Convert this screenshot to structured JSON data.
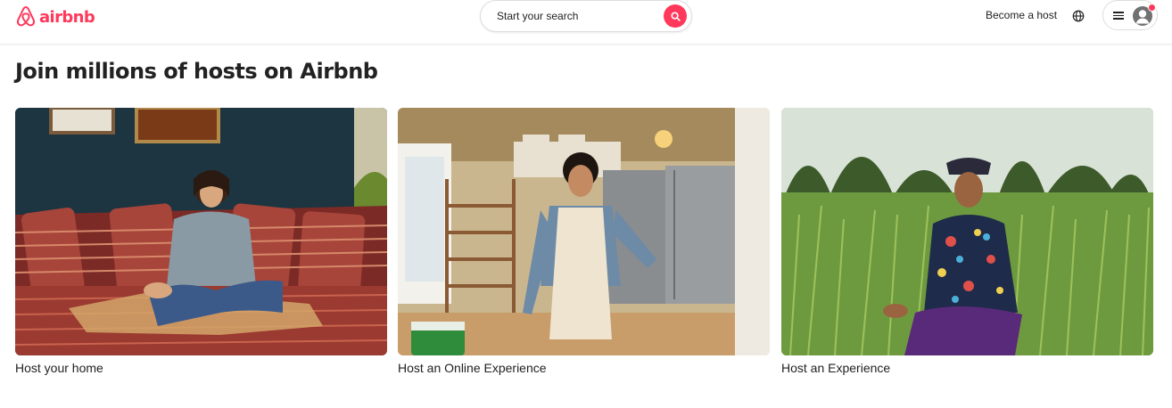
{
  "header": {
    "logo_text": "airbnb",
    "search_placeholder": "Start your search",
    "become_host": "Become a host",
    "icons": {
      "search": "search-icon",
      "globe": "globe-icon",
      "menu": "hamburger-menu-icon",
      "avatar": "user-avatar-icon"
    }
  },
  "main": {
    "title": "Join millions of hosts on Airbnb",
    "cards": [
      {
        "label": "Host your home",
        "image": "woman-on-striped-sofa"
      },
      {
        "label": "Host an Online Experience",
        "image": "man-in-apron-kitchen"
      },
      {
        "label": "Host an Experience",
        "image": "man-in-rice-field"
      }
    ]
  },
  "colors": {
    "brand": "#FF385C",
    "text": "#222222",
    "border": "#dddddd"
  }
}
